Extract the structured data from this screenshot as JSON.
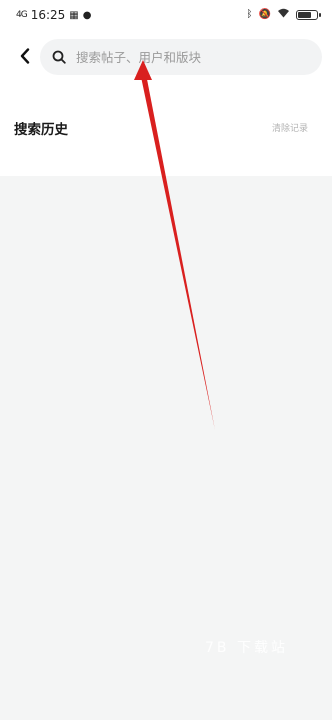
{
  "status_bar": {
    "signal": "4G",
    "time": "16:25",
    "battery_level": 0.7
  },
  "header": {
    "back_icon": "chevron-left-icon",
    "search": {
      "icon": "search-icon",
      "placeholder": "搜索帖子、用户和版块",
      "value": ""
    }
  },
  "history": {
    "title": "搜索历史",
    "clear_label": "清除记录"
  },
  "overlay": {
    "watermark": "7B 下载站",
    "arrow_color": "#d9201f"
  }
}
